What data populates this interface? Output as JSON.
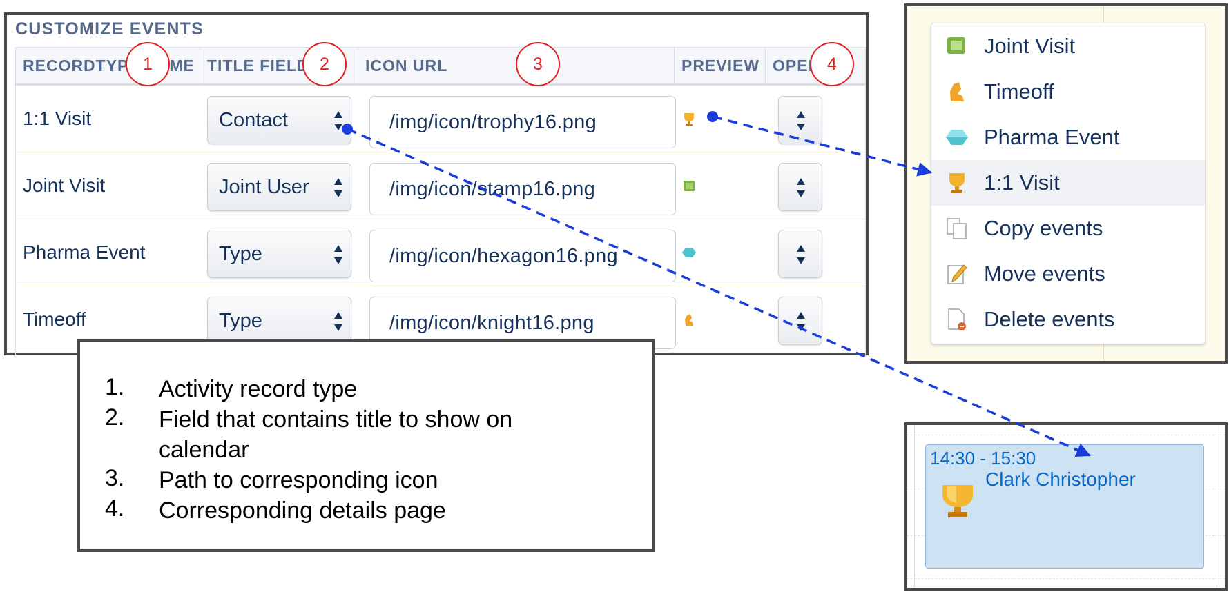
{
  "customize": {
    "title": "CUSTOMIZE EVENTS",
    "headers": {
      "recordtype": "RECORDTYPE NAME",
      "title_field": "TITLE FIELD",
      "icon_url": "ICON URL",
      "preview": "PREVIEW",
      "open": "OPEN"
    },
    "rows": [
      {
        "name": "1:1 Visit",
        "title_field": "Contact",
        "icon_url": "/img/icon/trophy16.png",
        "preview_icon": "trophy-icon",
        "open_value": ""
      },
      {
        "name": "Joint Visit",
        "title_field": "Joint User",
        "icon_url": "/img/icon/stamp16.png",
        "preview_icon": "stamp-icon",
        "open_value": ""
      },
      {
        "name": "Pharma Event",
        "title_field": "Type",
        "icon_url": "/img/icon/hexagon16.png",
        "preview_icon": "hexagon-icon",
        "open_value": ""
      },
      {
        "name": "Timeoff",
        "title_field": "Type",
        "icon_url": "/img/icon/knight16.png",
        "preview_icon": "knight-icon",
        "open_value": ""
      }
    ]
  },
  "callouts": [
    "1",
    "2",
    "3",
    "4"
  ],
  "legend": {
    "items": [
      {
        "num": "1.",
        "text": "Activity record type"
      },
      {
        "num": "2.",
        "text": "Field that contains title to show on calendar"
      },
      {
        "num": "3.",
        "text": "Path to corresponding icon"
      },
      {
        "num": "4.",
        "text": "Corresponding details page"
      }
    ]
  },
  "context_menu": {
    "items": [
      {
        "label": "Joint Visit",
        "icon": "stamp-icon",
        "active": false
      },
      {
        "label": "Timeoff",
        "icon": "knight-icon",
        "active": false
      },
      {
        "label": "Pharma Event",
        "icon": "hexagon-icon",
        "active": false
      },
      {
        "label": "1:1 Visit",
        "icon": "trophy-icon",
        "active": true
      },
      {
        "label": "Copy events",
        "icon": "copy-icon",
        "active": false
      },
      {
        "label": "Move events",
        "icon": "pencil-icon",
        "active": false
      },
      {
        "label": "Delete events",
        "icon": "delete-document-icon",
        "active": false
      }
    ]
  },
  "calendar_event": {
    "time": "14:30 - 15:30",
    "title": "Clark Christopher",
    "icon": "trophy-icon"
  },
  "colors": {
    "header_text": "#54698d",
    "body_text": "#16325c",
    "callout_red": "#e02020",
    "arrow_blue": "#1a3ddb",
    "event_bg": "#cde3f4",
    "event_text": "#0b68c2",
    "calendar_bg": "#fdfbea"
  }
}
